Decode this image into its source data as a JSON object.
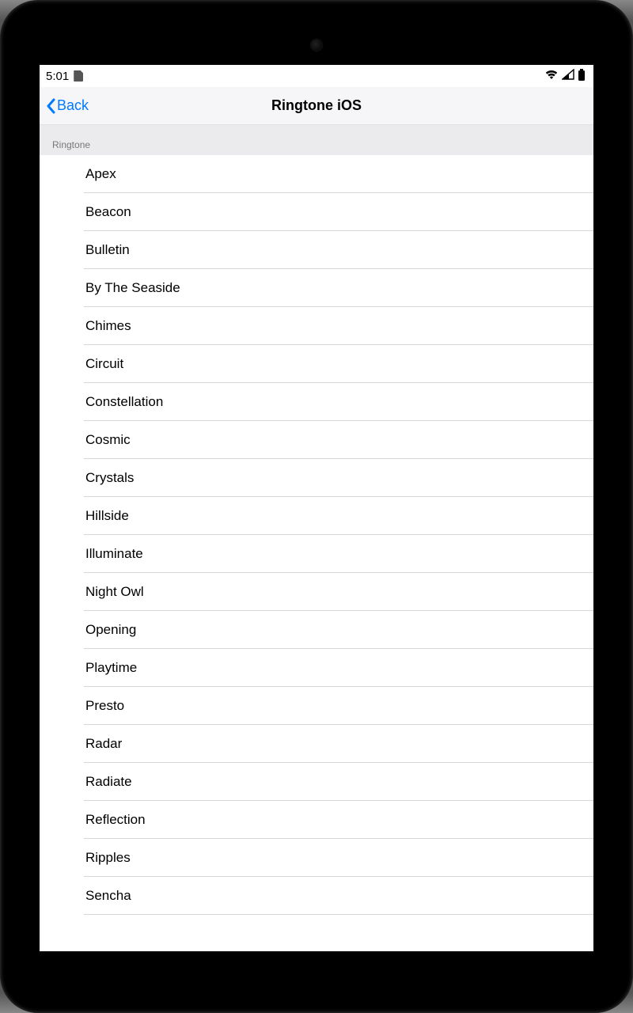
{
  "statusbar": {
    "time": "5:01"
  },
  "nav": {
    "back_label": "Back",
    "title": "Ringtone iOS"
  },
  "section_header": "Ringtone",
  "ringtones": [
    "Apex",
    "Beacon",
    "Bulletin",
    "By The Seaside",
    "Chimes",
    "Circuit",
    "Constellation",
    "Cosmic",
    "Crystals",
    "Hillside",
    "Illuminate",
    "Night Owl",
    "Opening",
    "Playtime",
    "Presto",
    "Radar",
    "Radiate",
    "Reflection",
    "Ripples",
    "Sencha"
  ]
}
